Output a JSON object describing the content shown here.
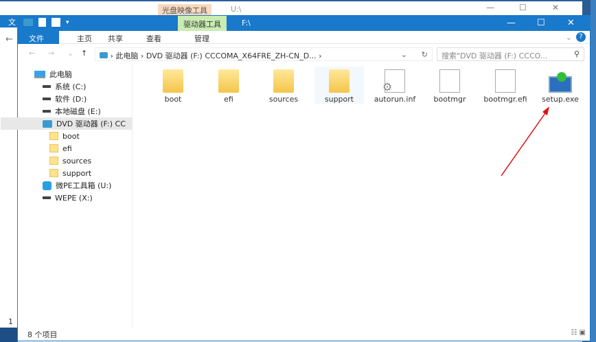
{
  "back_window": {
    "context_tab": "光盘映像工具",
    "path": "U:\\",
    "tab_fragment": "文",
    "line_number": "1"
  },
  "window": {
    "context_tab": "驱动器工具",
    "path": "F:\\",
    "controls": {
      "minimize": "—",
      "maximize": "☐",
      "close": "✕"
    },
    "ribbon_tabs": [
      "文件",
      "主页",
      "共享",
      "查看",
      "管理"
    ],
    "help": "?"
  },
  "address": {
    "breadcrumb": [
      "此电脑",
      "DVD 驱动器 (F:) CCCOMA_X64FRE_ZH-CN_D..."
    ],
    "search_placeholder": "搜索\"DVD 驱动器 (F:) CCCO..."
  },
  "nav": [
    {
      "label": "此电脑",
      "icon": "pc"
    },
    {
      "label": "系统 (C:)",
      "icon": "drive"
    },
    {
      "label": "软件 (D:)",
      "icon": "drive"
    },
    {
      "label": "本地磁盘 (E:)",
      "icon": "drive"
    },
    {
      "label": "DVD 驱动器 (F:) CC",
      "icon": "dvd",
      "selected": true
    },
    {
      "label": "boot",
      "icon": "folder"
    },
    {
      "label": "efi",
      "icon": "folder"
    },
    {
      "label": "sources",
      "icon": "folder"
    },
    {
      "label": "support",
      "icon": "folder"
    },
    {
      "label": "微PE工具箱 (U:)",
      "icon": "wepe"
    },
    {
      "label": "WEPE (X:)",
      "icon": "drive"
    }
  ],
  "files": [
    {
      "name": "boot",
      "type": "folder"
    },
    {
      "name": "efi",
      "type": "folder"
    },
    {
      "name": "sources",
      "type": "folder"
    },
    {
      "name": "support",
      "type": "folder"
    },
    {
      "name": "autorun.inf",
      "type": "settings"
    },
    {
      "name": "bootmgr",
      "type": "file"
    },
    {
      "name": "bootmgr.efi",
      "type": "file"
    },
    {
      "name": "setup.exe",
      "type": "exe"
    }
  ],
  "status": {
    "count": "8 个项目"
  },
  "annotation_color": "#e01010"
}
